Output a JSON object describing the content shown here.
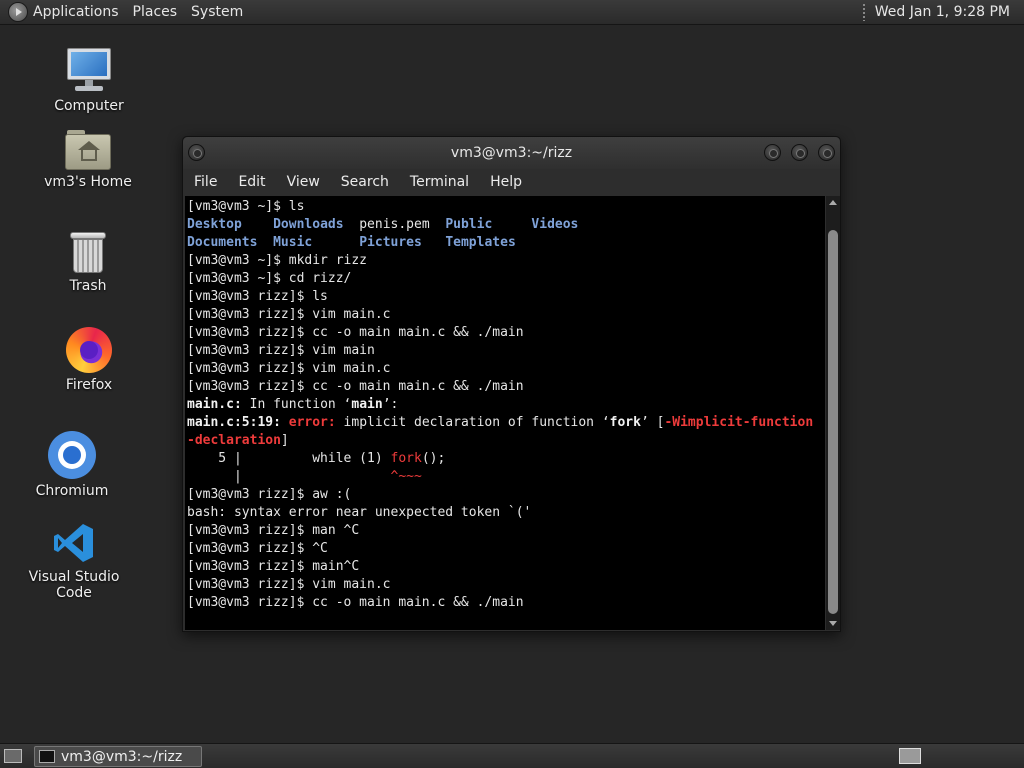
{
  "top_panel": {
    "menus": [
      "Applications",
      "Places",
      "System"
    ],
    "clock": "Wed Jan 1, 9:28 PM"
  },
  "desktop_icons": [
    {
      "label": "Computer",
      "icon": "computer-icon"
    },
    {
      "label": "vm3's Home",
      "icon": "home-folder-icon"
    },
    {
      "label": "Trash",
      "icon": "trash-icon"
    },
    {
      "label": "Firefox",
      "icon": "firefox-icon"
    },
    {
      "label": "Chromium",
      "icon": "chromium-icon"
    },
    {
      "label": "Visual Studio Code",
      "icon": "vscode-icon"
    }
  ],
  "terminal": {
    "title": "vm3@vm3:~/rizz",
    "menus": [
      "File",
      "Edit",
      "View",
      "Search",
      "Terminal",
      "Help"
    ],
    "lines": [
      [
        {
          "t": "[vm3@vm3 ~]$ ls",
          "c": ""
        }
      ],
      [
        {
          "t": "Desktop",
          "c": "dir"
        },
        {
          "t": "    ",
          "c": ""
        },
        {
          "t": "Downloads",
          "c": "dir"
        },
        {
          "t": "  penis.pem  ",
          "c": ""
        },
        {
          "t": "Public",
          "c": "dir"
        },
        {
          "t": "     ",
          "c": ""
        },
        {
          "t": "Videos",
          "c": "dir"
        }
      ],
      [
        {
          "t": "Documents",
          "c": "dir"
        },
        {
          "t": "  ",
          "c": ""
        },
        {
          "t": "Music",
          "c": "dir"
        },
        {
          "t": "      ",
          "c": ""
        },
        {
          "t": "Pictures",
          "c": "dir"
        },
        {
          "t": "   ",
          "c": ""
        },
        {
          "t": "Templates",
          "c": "dir"
        }
      ],
      [
        {
          "t": "[vm3@vm3 ~]$ mkdir rizz",
          "c": ""
        }
      ],
      [
        {
          "t": "[vm3@vm3 ~]$ cd rizz/",
          "c": ""
        }
      ],
      [
        {
          "t": "[vm3@vm3 rizz]$ ls",
          "c": ""
        }
      ],
      [
        {
          "t": "[vm3@vm3 rizz]$ vim main.c",
          "c": ""
        }
      ],
      [
        {
          "t": "[vm3@vm3 rizz]$ cc -o main main.c && ./main",
          "c": ""
        }
      ],
      [
        {
          "t": "[vm3@vm3 rizz]$ vim main",
          "c": ""
        }
      ],
      [
        {
          "t": "[vm3@vm3 rizz]$ vim main.c",
          "c": ""
        }
      ],
      [
        {
          "t": "[vm3@vm3 rizz]$ cc -o main main.c && ./main",
          "c": ""
        }
      ],
      [
        {
          "t": "main.c:",
          "c": "b"
        },
        {
          "t": " In function ‘",
          "c": ""
        },
        {
          "t": "main",
          "c": "b"
        },
        {
          "t": "’:",
          "c": ""
        }
      ],
      [
        {
          "t": "main.c:5:19: ",
          "c": "b"
        },
        {
          "t": "error: ",
          "c": "err"
        },
        {
          "t": "implicit declaration of function ‘",
          "c": ""
        },
        {
          "t": "fork",
          "c": "b"
        },
        {
          "t": "’ [",
          "c": ""
        },
        {
          "t": "-Wimplicit-function",
          "c": "err"
        }
      ],
      [
        {
          "t": "-declaration",
          "c": "err"
        },
        {
          "t": "]",
          "c": ""
        }
      ],
      [
        {
          "t": "    5 |         while (1) ",
          "c": ""
        },
        {
          "t": "fork",
          "c": "red"
        },
        {
          "t": "();",
          "c": ""
        }
      ],
      [
        {
          "t": "      |                   ",
          "c": ""
        },
        {
          "t": "^~~~",
          "c": "red"
        }
      ],
      [
        {
          "t": "[vm3@vm3 rizz]$ aw :(",
          "c": ""
        }
      ],
      [
        {
          "t": "bash: syntax error near unexpected token `('",
          "c": ""
        }
      ],
      [
        {
          "t": "[vm3@vm3 rizz]$ man ^C",
          "c": ""
        }
      ],
      [
        {
          "t": "[vm3@vm3 rizz]$ ^C",
          "c": ""
        }
      ],
      [
        {
          "t": "[vm3@vm3 rizz]$ main^C",
          "c": ""
        }
      ],
      [
        {
          "t": "[vm3@vm3 rizz]$ vim main.c",
          "c": ""
        }
      ],
      [
        {
          "t": "[vm3@vm3 rizz]$ cc -o main main.c && ./main",
          "c": ""
        }
      ]
    ]
  },
  "taskbar": {
    "window_label": "vm3@vm3:~/rizz"
  },
  "colors": {
    "directory": "#7fa2d8",
    "error": "#ee3b3b",
    "desktop_bg": "#262626"
  }
}
